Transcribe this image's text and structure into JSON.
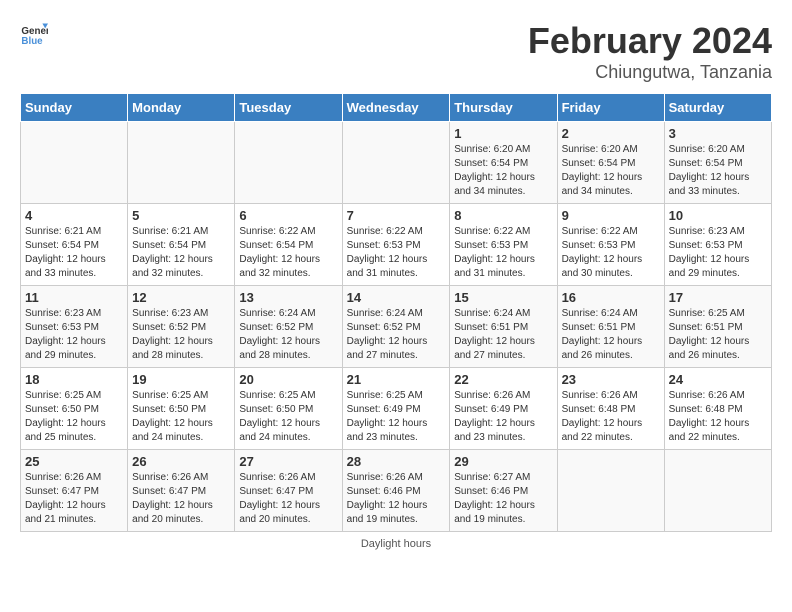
{
  "header": {
    "logo_general": "General",
    "logo_blue": "Blue",
    "title": "February 2024",
    "location": "Chiungutwa, Tanzania"
  },
  "calendar": {
    "days_of_week": [
      "Sunday",
      "Monday",
      "Tuesday",
      "Wednesday",
      "Thursday",
      "Friday",
      "Saturday"
    ],
    "weeks": [
      [
        {
          "day": "",
          "info": ""
        },
        {
          "day": "",
          "info": ""
        },
        {
          "day": "",
          "info": ""
        },
        {
          "day": "",
          "info": ""
        },
        {
          "day": "1",
          "info": "Sunrise: 6:20 AM\nSunset: 6:54 PM\nDaylight: 12 hours and 34 minutes."
        },
        {
          "day": "2",
          "info": "Sunrise: 6:20 AM\nSunset: 6:54 PM\nDaylight: 12 hours and 34 minutes."
        },
        {
          "day": "3",
          "info": "Sunrise: 6:20 AM\nSunset: 6:54 PM\nDaylight: 12 hours and 33 minutes."
        }
      ],
      [
        {
          "day": "4",
          "info": "Sunrise: 6:21 AM\nSunset: 6:54 PM\nDaylight: 12 hours and 33 minutes."
        },
        {
          "day": "5",
          "info": "Sunrise: 6:21 AM\nSunset: 6:54 PM\nDaylight: 12 hours and 32 minutes."
        },
        {
          "day": "6",
          "info": "Sunrise: 6:22 AM\nSunset: 6:54 PM\nDaylight: 12 hours and 32 minutes."
        },
        {
          "day": "7",
          "info": "Sunrise: 6:22 AM\nSunset: 6:53 PM\nDaylight: 12 hours and 31 minutes."
        },
        {
          "day": "8",
          "info": "Sunrise: 6:22 AM\nSunset: 6:53 PM\nDaylight: 12 hours and 31 minutes."
        },
        {
          "day": "9",
          "info": "Sunrise: 6:22 AM\nSunset: 6:53 PM\nDaylight: 12 hours and 30 minutes."
        },
        {
          "day": "10",
          "info": "Sunrise: 6:23 AM\nSunset: 6:53 PM\nDaylight: 12 hours and 29 minutes."
        }
      ],
      [
        {
          "day": "11",
          "info": "Sunrise: 6:23 AM\nSunset: 6:53 PM\nDaylight: 12 hours and 29 minutes."
        },
        {
          "day": "12",
          "info": "Sunrise: 6:23 AM\nSunset: 6:52 PM\nDaylight: 12 hours and 28 minutes."
        },
        {
          "day": "13",
          "info": "Sunrise: 6:24 AM\nSunset: 6:52 PM\nDaylight: 12 hours and 28 minutes."
        },
        {
          "day": "14",
          "info": "Sunrise: 6:24 AM\nSunset: 6:52 PM\nDaylight: 12 hours and 27 minutes."
        },
        {
          "day": "15",
          "info": "Sunrise: 6:24 AM\nSunset: 6:51 PM\nDaylight: 12 hours and 27 minutes."
        },
        {
          "day": "16",
          "info": "Sunrise: 6:24 AM\nSunset: 6:51 PM\nDaylight: 12 hours and 26 minutes."
        },
        {
          "day": "17",
          "info": "Sunrise: 6:25 AM\nSunset: 6:51 PM\nDaylight: 12 hours and 26 minutes."
        }
      ],
      [
        {
          "day": "18",
          "info": "Sunrise: 6:25 AM\nSunset: 6:50 PM\nDaylight: 12 hours and 25 minutes."
        },
        {
          "day": "19",
          "info": "Sunrise: 6:25 AM\nSunset: 6:50 PM\nDaylight: 12 hours and 24 minutes."
        },
        {
          "day": "20",
          "info": "Sunrise: 6:25 AM\nSunset: 6:50 PM\nDaylight: 12 hours and 24 minutes."
        },
        {
          "day": "21",
          "info": "Sunrise: 6:25 AM\nSunset: 6:49 PM\nDaylight: 12 hours and 23 minutes."
        },
        {
          "day": "22",
          "info": "Sunrise: 6:26 AM\nSunset: 6:49 PM\nDaylight: 12 hours and 23 minutes."
        },
        {
          "day": "23",
          "info": "Sunrise: 6:26 AM\nSunset: 6:48 PM\nDaylight: 12 hours and 22 minutes."
        },
        {
          "day": "24",
          "info": "Sunrise: 6:26 AM\nSunset: 6:48 PM\nDaylight: 12 hours and 22 minutes."
        }
      ],
      [
        {
          "day": "25",
          "info": "Sunrise: 6:26 AM\nSunset: 6:47 PM\nDaylight: 12 hours and 21 minutes."
        },
        {
          "day": "26",
          "info": "Sunrise: 6:26 AM\nSunset: 6:47 PM\nDaylight: 12 hours and 20 minutes."
        },
        {
          "day": "27",
          "info": "Sunrise: 6:26 AM\nSunset: 6:47 PM\nDaylight: 12 hours and 20 minutes."
        },
        {
          "day": "28",
          "info": "Sunrise: 6:26 AM\nSunset: 6:46 PM\nDaylight: 12 hours and 19 minutes."
        },
        {
          "day": "29",
          "info": "Sunrise: 6:27 AM\nSunset: 6:46 PM\nDaylight: 12 hours and 19 minutes."
        },
        {
          "day": "",
          "info": ""
        },
        {
          "day": "",
          "info": ""
        }
      ]
    ]
  },
  "footer": {
    "note": "Daylight hours"
  }
}
